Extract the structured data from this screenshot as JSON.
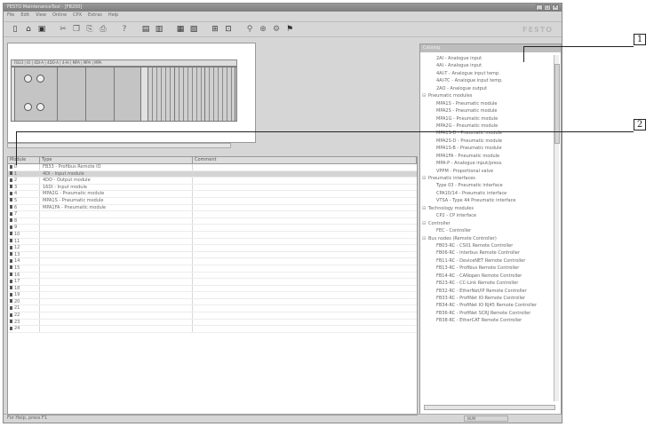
{
  "window": {
    "title": "FESTO MaintenanceTool - [FB200]",
    "controls": [
      "_",
      "□",
      "×"
    ]
  },
  "menu": [
    "File",
    "Edit",
    "View",
    "Online",
    "CPX",
    "Extras",
    "Help"
  ],
  "toolbar": {
    "icons": [
      "new-icon",
      "open-icon",
      "save-icon",
      "cut-icon",
      "copy-icon",
      "paste-icon",
      "print-icon",
      "info-icon",
      "module-icon",
      "module2-icon",
      "grid-icon",
      "grid2-icon",
      "tree-icon",
      "tree2-icon",
      "find-icon",
      "online-icon",
      "settings-icon",
      "flag-icon"
    ]
  },
  "brand": "FESTO",
  "hardware": {
    "header": "FB33  |  IO  |  4DI-A  |  4DO-A  |  4-AI  |  MPA  |  MPA  |  MPA"
  },
  "table": {
    "headers": [
      "Module",
      "Type",
      "Comment"
    ],
    "rows": [
      {
        "num": "0",
        "type": "FB33 - Profibus Remote IO",
        "comment": ""
      },
      {
        "num": "1",
        "type": "4DI - Input module",
        "comment": ""
      },
      {
        "num": "2",
        "type": "4DO - Output module",
        "comment": ""
      },
      {
        "num": "3",
        "type": "16DI - Input module",
        "comment": ""
      },
      {
        "num": "4",
        "type": "MPA2G - Pneumatic module",
        "comment": ""
      },
      {
        "num": "5",
        "type": "MPA1S - Pneumatic module",
        "comment": ""
      },
      {
        "num": "6",
        "type": "MPA1FA - Pneumatic module",
        "comment": ""
      },
      {
        "num": "7",
        "type": "",
        "comment": ""
      },
      {
        "num": "8",
        "type": "",
        "comment": ""
      },
      {
        "num": "9",
        "type": "",
        "comment": ""
      },
      {
        "num": "10",
        "type": "",
        "comment": ""
      },
      {
        "num": "11",
        "type": "",
        "comment": ""
      },
      {
        "num": "12",
        "type": "",
        "comment": ""
      },
      {
        "num": "13",
        "type": "",
        "comment": ""
      },
      {
        "num": "14",
        "type": "",
        "comment": ""
      },
      {
        "num": "15",
        "type": "",
        "comment": ""
      },
      {
        "num": "16",
        "type": "",
        "comment": ""
      },
      {
        "num": "17",
        "type": "",
        "comment": ""
      },
      {
        "num": "18",
        "type": "",
        "comment": ""
      },
      {
        "num": "19",
        "type": "",
        "comment": ""
      },
      {
        "num": "20",
        "type": "",
        "comment": ""
      },
      {
        "num": "21",
        "type": "",
        "comment": ""
      },
      {
        "num": "22",
        "type": "",
        "comment": ""
      },
      {
        "num": "23",
        "type": "",
        "comment": ""
      },
      {
        "num": "24",
        "type": "",
        "comment": ""
      }
    ]
  },
  "catalog": {
    "title": "Catalog",
    "items": [
      {
        "level": 1,
        "label": "2AI - Analogue input"
      },
      {
        "level": 1,
        "label": "4AI - Analogue input"
      },
      {
        "level": 1,
        "label": "4AI-T - Analogue input temp."
      },
      {
        "level": 1,
        "label": "4AI-TC - Analogue input temp."
      },
      {
        "level": 1,
        "label": "2AO - Analogue output"
      },
      {
        "level": 0,
        "label": "Pneumatic modules"
      },
      {
        "level": 1,
        "label": "MPA1S - Pneumatic module"
      },
      {
        "level": 1,
        "label": "MPA2S - Pneumatic module"
      },
      {
        "level": 1,
        "label": "MPA1G - Pneumatic module"
      },
      {
        "level": 1,
        "label": "MPA2G - Pneumatic module"
      },
      {
        "level": 1,
        "label": "MPA1S-D - Pneumatic module"
      },
      {
        "level": 1,
        "label": "MPA2S-D - Pneumatic module"
      },
      {
        "level": 1,
        "label": "MPA1S-B - Pneumatic module"
      },
      {
        "level": 1,
        "label": "MPA1FA - Pneumatic module"
      },
      {
        "level": 1,
        "label": "MPA-P - Analogue input/press."
      },
      {
        "level": 1,
        "label": "VPPM - Proportional valve"
      },
      {
        "level": 0,
        "label": "Pneumatic interfaces"
      },
      {
        "level": 1,
        "label": "Type 03 - Pneumatic interface"
      },
      {
        "level": 1,
        "label": "CPA10/14 - Pneumatic interface"
      },
      {
        "level": 1,
        "label": "VTSA - Type 44 Pneumatic interface"
      },
      {
        "level": 0,
        "label": "Technology modules"
      },
      {
        "level": 1,
        "label": "CP2 - CP interface"
      },
      {
        "level": 0,
        "label": "Controller"
      },
      {
        "level": 1,
        "label": "FEC - Controller"
      },
      {
        "level": 0,
        "label": "Bus nodes (Remote Controller)"
      },
      {
        "level": 1,
        "label": "FB03-RC - CS01 Remote Controller"
      },
      {
        "level": 1,
        "label": "FB06-RC - Interbus Remote Controller"
      },
      {
        "level": 1,
        "label": "FB11-RC - DeviceNET Remote Controller"
      },
      {
        "level": 1,
        "label": "FB13-RC - Profibus Remote Controller"
      },
      {
        "level": 1,
        "label": "FB14-RC - CANopen Remote Controller"
      },
      {
        "level": 1,
        "label": "FB23-RC - CC-Link Remote Controller"
      },
      {
        "level": 1,
        "label": "FB32-RC - EtherNet/IP Remote Controller"
      },
      {
        "level": 1,
        "label": "FB33-RC - ProfiNet IO Remote Controller"
      },
      {
        "level": 1,
        "label": "FB34-RC - ProfiNet IO RJ45 Remote Controller"
      },
      {
        "level": 1,
        "label": "FB36-RC - ProfiNet SCRJ Remote Controller"
      },
      {
        "level": 1,
        "label": "FB38-RC - EtherCAT Remote Controller"
      }
    ]
  },
  "status": {
    "left": "For Help, press F1",
    "panel": "NUM"
  },
  "callouts": [
    "1",
    "2"
  ]
}
